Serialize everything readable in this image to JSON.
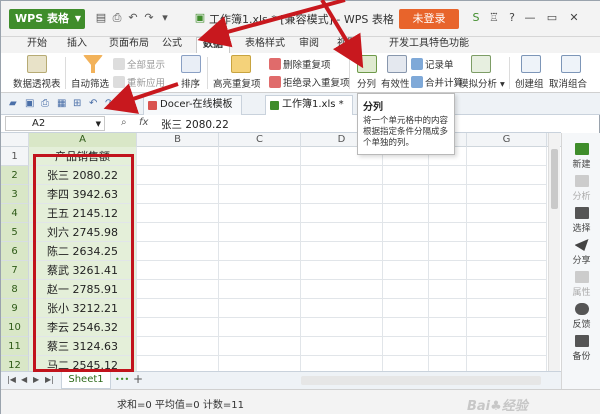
{
  "window": {
    "app_label": "WPS 表格",
    "doc_title": "工作簿1.xls * [兼容模式] - WPS 表格",
    "login_label": "未登录"
  },
  "menu": {
    "tabs": [
      "开始",
      "插入",
      "页面布局",
      "公式",
      "数据",
      "表格样式",
      "审阅",
      "视图",
      "开发工具",
      "特色功能"
    ],
    "active_tab": "数据"
  },
  "ribbon": {
    "pivot": "数据透视表",
    "autofilter": "自动筛选",
    "show_all": "全部显示",
    "reapply": "重新应用",
    "sort": "排序",
    "highlight_dup": "高亮重复项",
    "remove_dup": "删除重复项",
    "reject_dup": "拒绝录入重复项",
    "split": "分列",
    "validity": "有效性",
    "record": "记录单",
    "merge_calc": "合并计算",
    "simulate": "模拟分析",
    "group": "创建组",
    "ungroup": "取消组合"
  },
  "tabbar": {
    "tabs": [
      "Docer-在线模板",
      "工作簿1.xls *"
    ]
  },
  "tooltip": {
    "title": "分列",
    "body": "将一个单元格中的内容根据指定条件分隔成多个单独的列。"
  },
  "formula_bar": {
    "cell_ref": "A2",
    "fx": "fx",
    "value": "张三  2080.22"
  },
  "grid": {
    "columns": [
      "A",
      "B",
      "C",
      "D",
      "E",
      "F",
      "G"
    ],
    "rows": [
      {
        "num": "1",
        "a": "产品销售额"
      },
      {
        "num": "2",
        "a": "张三  2080.22"
      },
      {
        "num": "3",
        "a": "李四  3942.63"
      },
      {
        "num": "4",
        "a": "王五  2145.12"
      },
      {
        "num": "5",
        "a": "刘六  2745.98"
      },
      {
        "num": "6",
        "a": "陈二  2634.25"
      },
      {
        "num": "7",
        "a": "蔡武  3261.41"
      },
      {
        "num": "8",
        "a": "赵一  2785.91"
      },
      {
        "num": "9",
        "a": "张小  3212.21"
      },
      {
        "num": "10",
        "a": "李云  2546.32"
      },
      {
        "num": "11",
        "a": "蔡三  3124.63"
      },
      {
        "num": "12",
        "a": "马二  2545.12"
      }
    ]
  },
  "side_panel": {
    "items": [
      "新建",
      "分析",
      "选择",
      "分享",
      "属性",
      "反馈",
      "备份"
    ]
  },
  "sheets": {
    "tab": "Sheet1"
  },
  "status": {
    "text": "求和=0  平均值=0  计数=11"
  },
  "colors": {
    "accent_green": "#3f8d2b",
    "login_orange": "#e8642b",
    "highlight_red": "#c1131c",
    "arrow_red": "#c8181e"
  }
}
